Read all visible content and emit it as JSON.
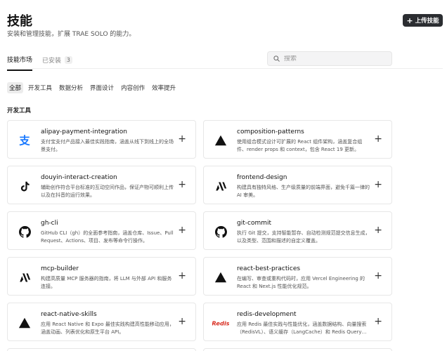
{
  "header": {
    "title": "技能",
    "subtitle": "安装和管理技能，扩展 TRAE SOLO 的能力。",
    "upload_label": "上传技能"
  },
  "tabs": [
    {
      "label": "技能市场",
      "count": ""
    },
    {
      "label": "已安装",
      "count": "3"
    }
  ],
  "search": {
    "placeholder": "搜索"
  },
  "filters": [
    "全部",
    "开发工具",
    "数据分析",
    "界面设计",
    "内容创作",
    "效率提升"
  ],
  "section_title": "开发工具",
  "cards": [
    {
      "name": "alipay-payment-integration",
      "desc": "支付宝支付产品接入最佳实践指南，涵盖从线下到线上的全场景支付。",
      "icon": "alipay-icon"
    },
    {
      "name": "composition-patterns",
      "desc": "使用组合模式设计可扩展的 React 组件架构，涵盖复合组件、render props 和 context，包含 React 19 更新。",
      "icon": "vercel-triangle-icon"
    },
    {
      "name": "douyin-interact-creation",
      "desc": "辅助创作符合平台标准的互动空间作品，保证产物可顺利上传以及在抖音的运行效果。",
      "icon": "tiktok-icon"
    },
    {
      "name": "frontend-design",
      "desc": "构建具有独特风格、生产级质量的前端界面，避免千篇一律的 AI 审美。",
      "icon": "anthropic-icon"
    },
    {
      "name": "gh-cli",
      "desc": "GitHub CLI（gh）的全面参考指南，涵盖仓库、Issue、Pull Request、Actions、项目、发布等命令行操作。",
      "icon": "github-icon"
    },
    {
      "name": "git-commit",
      "desc": "执行 Git 提交，支持智能暂存、自动检测规范提交信息生成，以及类型、范围和描述的自定义覆盖。",
      "icon": "github-icon"
    },
    {
      "name": "mcp-builder",
      "desc": "构建高质量 MCP 服务器的指南，将 LLM 与外部 API 和服务连接。",
      "icon": "anthropic-icon"
    },
    {
      "name": "react-best-practices",
      "desc": "在编写、审查或重构代码时，应用 Vercel Engineering 的 React 和 Next.js 性能优化规范。",
      "icon": "vercel-triangle-icon"
    },
    {
      "name": "react-native-skills",
      "desc": "应用 React Native 和 Expo 最佳实践构建高性能移动应用，涵盖动画、列表优化和原生平台 API。",
      "icon": "vercel-triangle-icon"
    },
    {
      "name": "redis-development",
      "desc": "应用 Redis 最佳实践与性能优化，涵盖数据结构、向量搜索（RedisVL）、语义缓存（LangCache）和 Redis Query…",
      "icon": "redis-icon"
    }
  ],
  "icons": {
    "alipay_color": "#1677ff",
    "redis_color": "#d82c20",
    "redis_label": "Redis"
  }
}
